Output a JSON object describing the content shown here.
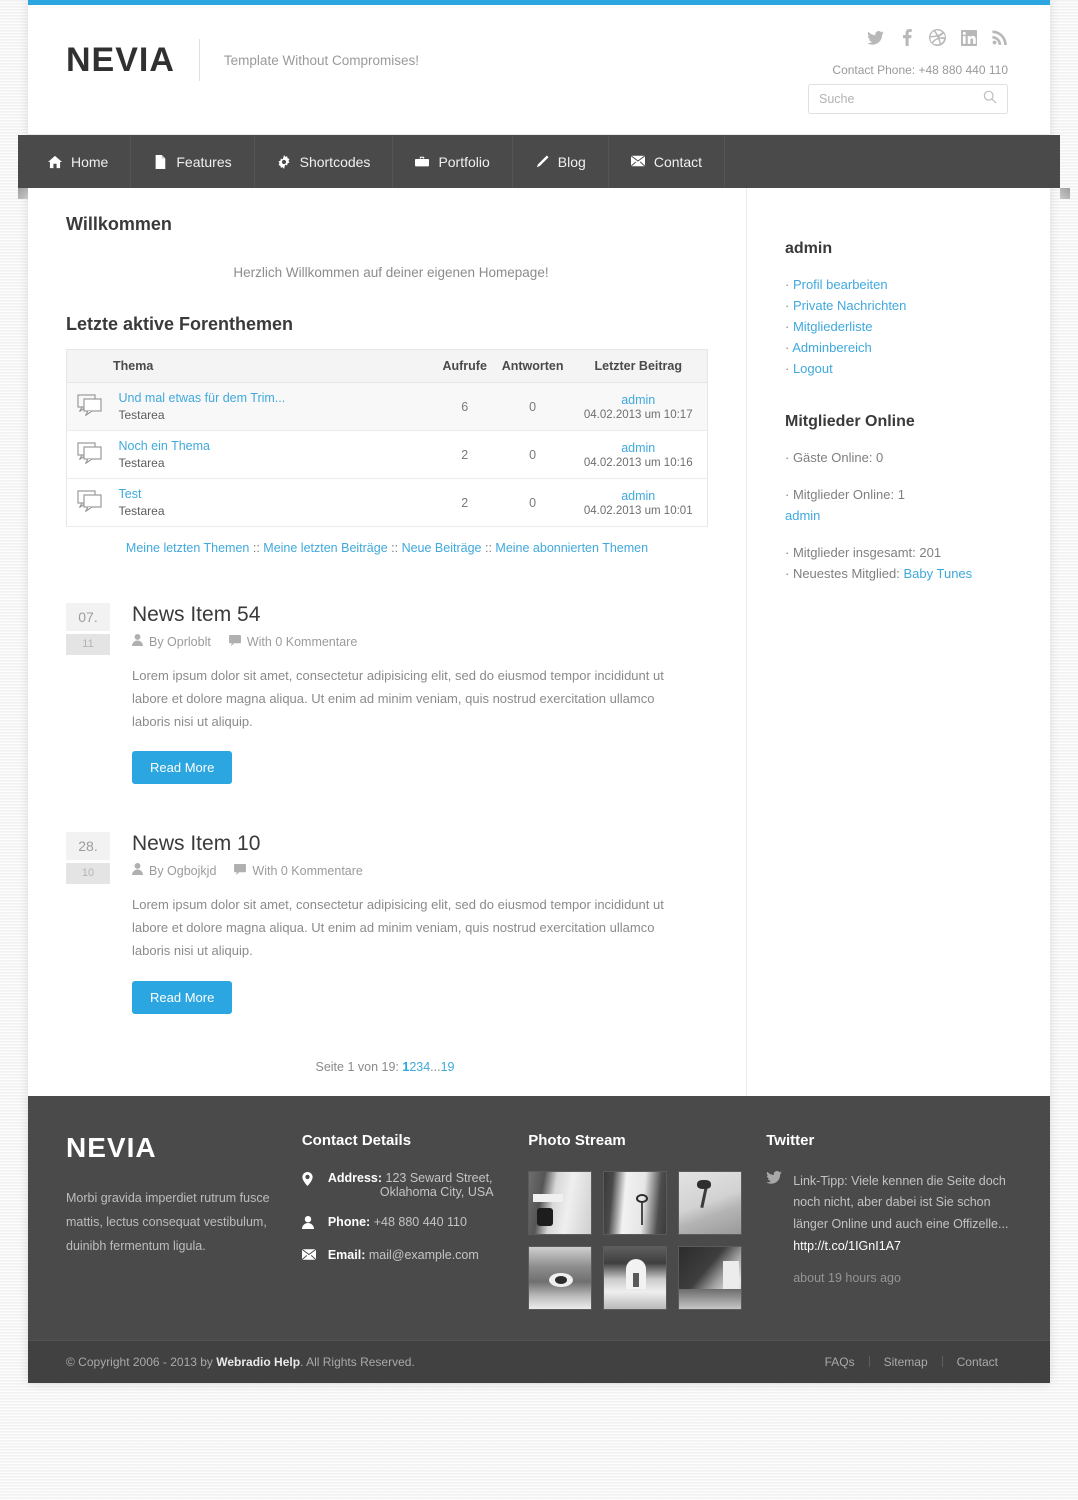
{
  "theme": {
    "accent": "#2ba6e0",
    "link": "#3fa9dd",
    "dark": "#4a4a4a",
    "darker": "#414141"
  },
  "header": {
    "logo": "NEVIA",
    "tagline": "Template Without Compromises!",
    "phone": "Contact Phone: +48 880 440 110",
    "social": [
      "twitter-icon",
      "facebook-icon",
      "dribbble-icon",
      "linkedin-icon",
      "rss-icon"
    ],
    "search": {
      "placeholder": "Suche",
      "value": "",
      "icon": "search-icon"
    }
  },
  "nav": [
    {
      "label": "Home",
      "icon": "home-icon"
    },
    {
      "label": "Features",
      "icon": "file-icon"
    },
    {
      "label": "Shortcodes",
      "icon": "gear-icon"
    },
    {
      "label": "Portfolio",
      "icon": "briefcase-icon"
    },
    {
      "label": "Blog",
      "icon": "pencil-icon"
    },
    {
      "label": "Contact",
      "icon": "envelope-icon"
    }
  ],
  "main": {
    "welcome_title": "Willkommen",
    "welcome_message": "Herzlich Willkommen auf deiner eigenen Homepage!",
    "forum_title": "Letzte aktive Forenthemen",
    "forum_table": {
      "columns": [
        "Thema",
        "Aufrufe",
        "Antworten",
        "Letzter Beitrag"
      ],
      "rows": [
        {
          "topic": "Und mal etwas für dem Trim...",
          "area": "Testarea",
          "views": "6",
          "replies": "0",
          "last_author": "admin",
          "last_date": "04.02.2013 um 10:17"
        },
        {
          "topic": "Noch ein Thema",
          "area": "Testarea",
          "views": "2",
          "replies": "0",
          "last_author": "admin",
          "last_date": "04.02.2013 um 10:16"
        },
        {
          "topic": "Test",
          "area": "Testarea",
          "views": "2",
          "replies": "0",
          "last_author": "admin",
          "last_date": "04.02.2013 um 10:01"
        }
      ]
    },
    "forum_links": [
      "Meine letzten Themen",
      "Meine letzten Beiträge",
      "Neue Beiträge",
      "Meine abonnierten Themen"
    ],
    "forum_links_sep": " :: ",
    "news": [
      {
        "day": "07.",
        "month": "11",
        "title": "News Item 54",
        "author": "By Oprloblt",
        "comments": "With 0 Kommentare",
        "author_icon": "user-icon",
        "comment_icon": "comment-icon",
        "text": "Lorem ipsum dolor sit amet, consectetur adipisicing elit, sed do eiusmod tempor incididunt ut labore et dolore magna aliqua. Ut enim ad minim veniam, quis nostrud exercitation ullamco laboris nisi ut aliquip.",
        "button": "Read More"
      },
      {
        "day": "28.",
        "month": "10",
        "title": "News Item 10",
        "author": "By Ogbojkjd",
        "comments": "With 0 Kommentare",
        "author_icon": "user-icon",
        "comment_icon": "comment-icon",
        "text": "Lorem ipsum dolor sit amet, consectetur adipisicing elit, sed do eiusmod tempor incididunt ut labore et dolore magna aliqua. Ut enim ad minim veniam, quis nostrud exercitation ullamco laboris nisi ut aliquip.",
        "button": "Read More"
      }
    ],
    "pagination": {
      "label": "Seite 1 von 19: ",
      "current": "1",
      "pages": [
        "2",
        "3",
        "4"
      ],
      "ellipsis": "...",
      "last": "19"
    }
  },
  "sidebar": {
    "user_title": "admin",
    "user_links": [
      "Profil bearbeiten",
      "Private Nachrichten",
      "Mitgliederliste",
      "Adminbereich",
      "Logout"
    ],
    "online_title": "Mitglieder Online",
    "guests_online": "· Gäste Online: 0",
    "members_online": "· Mitglieder Online: 1",
    "member_name": "admin",
    "total_members": "· Mitglieder insgesamt: 201",
    "newest_label": "· Neuestes Mitglied: ",
    "newest_member": "Baby Tunes"
  },
  "footer": {
    "logo": "NEVIA",
    "about": "Morbi gravida imperdiet rutrum fusce mattis, lectus consequat vestibulum, duinibh fermentum ligula.",
    "contact_title": "Contact Details",
    "address_label": "Address:",
    "address_line1": "123 Seward Street,",
    "address_line2": "Oklahoma City, USA",
    "address_icon": "map-pin-icon",
    "phone_label": "Phone:",
    "phone_value": "+48 880 440 110",
    "phone_icon": "user-icon",
    "email_label": "Email:",
    "email_value": "mail@example.com",
    "email_icon": "envelope-icon",
    "photo_title": "Photo Stream",
    "photo_count": 6,
    "twitter_title": "Twitter",
    "twitter_icon": "twitter-icon",
    "tweet_text": "Link-Tipp: Viele kennen die Seite doch noch nicht, aber dabei ist Sie schon länger Online und auch eine Offizelle... ",
    "tweet_link": "http://t.co/1IGnI1A7",
    "tweet_time": "about 19 hours ago",
    "copyright_pre": "© Copyright 2006 - 2013 by ",
    "copyright_brand": "Webradio Help",
    "copyright_post": ". All Rights Reserved.",
    "bottom_links": [
      "FAQs",
      "Sitemap",
      "Contact"
    ]
  }
}
